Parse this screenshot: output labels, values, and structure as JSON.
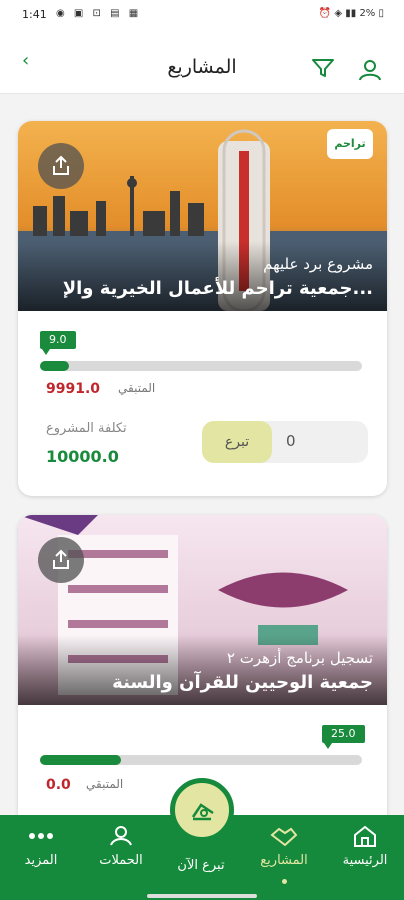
{
  "status_bar": {
    "time": "1:41",
    "battery": "2%"
  },
  "header": {
    "title": "المشاريع"
  },
  "projects": [
    {
      "subtitle": "مشروع برد عليهم",
      "name": "جمعية تراحم للأعمال الخيرية والإ...",
      "logo_text": "تراحم",
      "progress": 9.0,
      "progress_label": "9.0",
      "remaining_label": "المتبقي",
      "remaining_value": "9991.0",
      "cost_label": "تكلفة المشروع",
      "cost_value": "10000.0",
      "donate_label": "تبرع",
      "amount_value": "0"
    },
    {
      "subtitle": "تسجيل برنامج أزهرت ٢",
      "name": "جمعية الوحيين للقرآن والسنة",
      "progress": 25.0,
      "progress_label": "25.0",
      "remaining_label": "المتبقي",
      "remaining_value": "0.0"
    }
  ],
  "bottom_nav": {
    "items": [
      {
        "label": "المزيد"
      },
      {
        "label": "الحملات"
      },
      {
        "label": "تبرع الآن"
      },
      {
        "label": "المشاريع"
      },
      {
        "label": "الرئيسية"
      }
    ]
  },
  "colors": {
    "primary": "#168a3c",
    "accent": "#e3e6a2",
    "danger": "#c0262d"
  }
}
